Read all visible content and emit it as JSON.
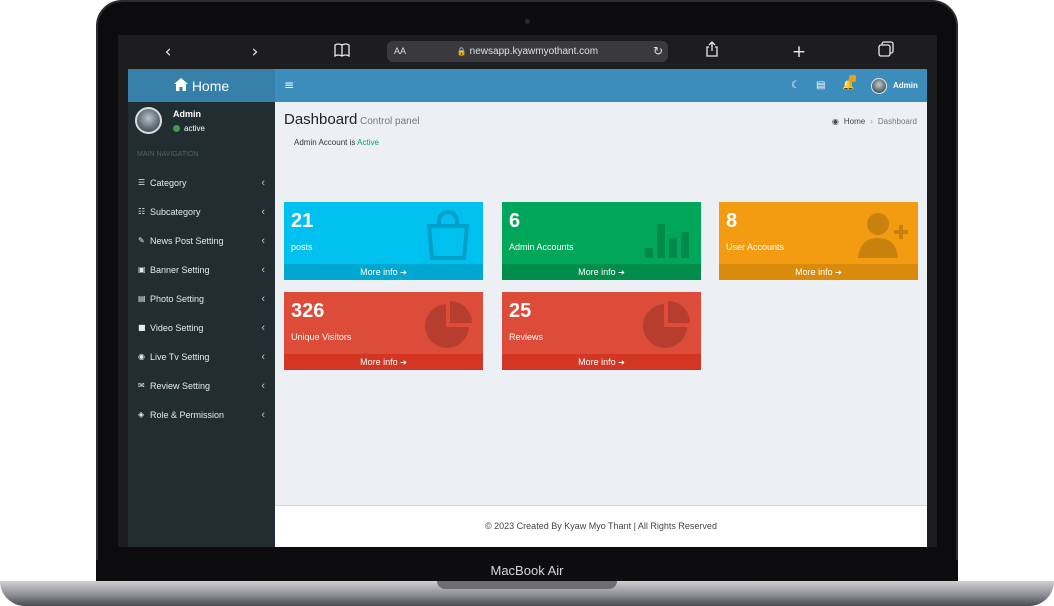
{
  "device": {
    "brand": "MacBook Air"
  },
  "browser": {
    "back_icon": "chevron-left-icon",
    "forward_icon": "chevron-right-icon",
    "aa": "AA",
    "url": "newsapp.kyawmyothant.com"
  },
  "sidebar": {
    "home_label": "Home",
    "user_name": "Admin",
    "user_status": "active",
    "nav_header": "MAIN NAVIGATION",
    "items": [
      {
        "label": "Category",
        "icon": "list-icon"
      },
      {
        "label": "Subcategory",
        "icon": "list-ol-icon"
      },
      {
        "label": "News Post Setting",
        "icon": "blog-icon"
      },
      {
        "label": "Banner Setting",
        "icon": "font-icon"
      },
      {
        "label": "Photo Setting",
        "icon": "images-icon"
      },
      {
        "label": "Video Setting",
        "icon": "video-icon"
      },
      {
        "label": "Live Tv Setting",
        "icon": "dot-circle-icon"
      },
      {
        "label": "Review Setting",
        "icon": "comments-icon"
      },
      {
        "label": "Role & Permission",
        "icon": "shield-icon"
      }
    ]
  },
  "topnav": {
    "user_label": "Admin"
  },
  "header": {
    "title": "Dashboard",
    "subtitle": "Control panel",
    "breadcrumb_home": "Home",
    "breadcrumb_current": "Dashboard",
    "status_prefix": "Admin Account is",
    "status_value": "Active"
  },
  "boxes": [
    {
      "number": "21",
      "label": "posts",
      "more": "More info",
      "color": "#00c0ef",
      "icon": "shopping-bag-icon"
    },
    {
      "number": "6",
      "label": "Admin Accounts",
      "more": "More info",
      "color": "#00a65a",
      "icon": "bar-chart-icon"
    },
    {
      "number": "8",
      "label": "User Accounts",
      "more": "More info",
      "color": "#f39c12",
      "icon": "user-plus-icon"
    },
    {
      "number": "326",
      "label": "Unique Visitors",
      "more": "More info",
      "color": "#dd4b39",
      "icon": "pie-chart-icon"
    },
    {
      "number": "25",
      "label": "Reviews",
      "more": "More info",
      "color": "#dd4b39",
      "icon": "pie-chart-icon"
    }
  ],
  "footer": {
    "text": "© 2023 Created By Kyaw Myo Thant | All Rights Reserved"
  }
}
